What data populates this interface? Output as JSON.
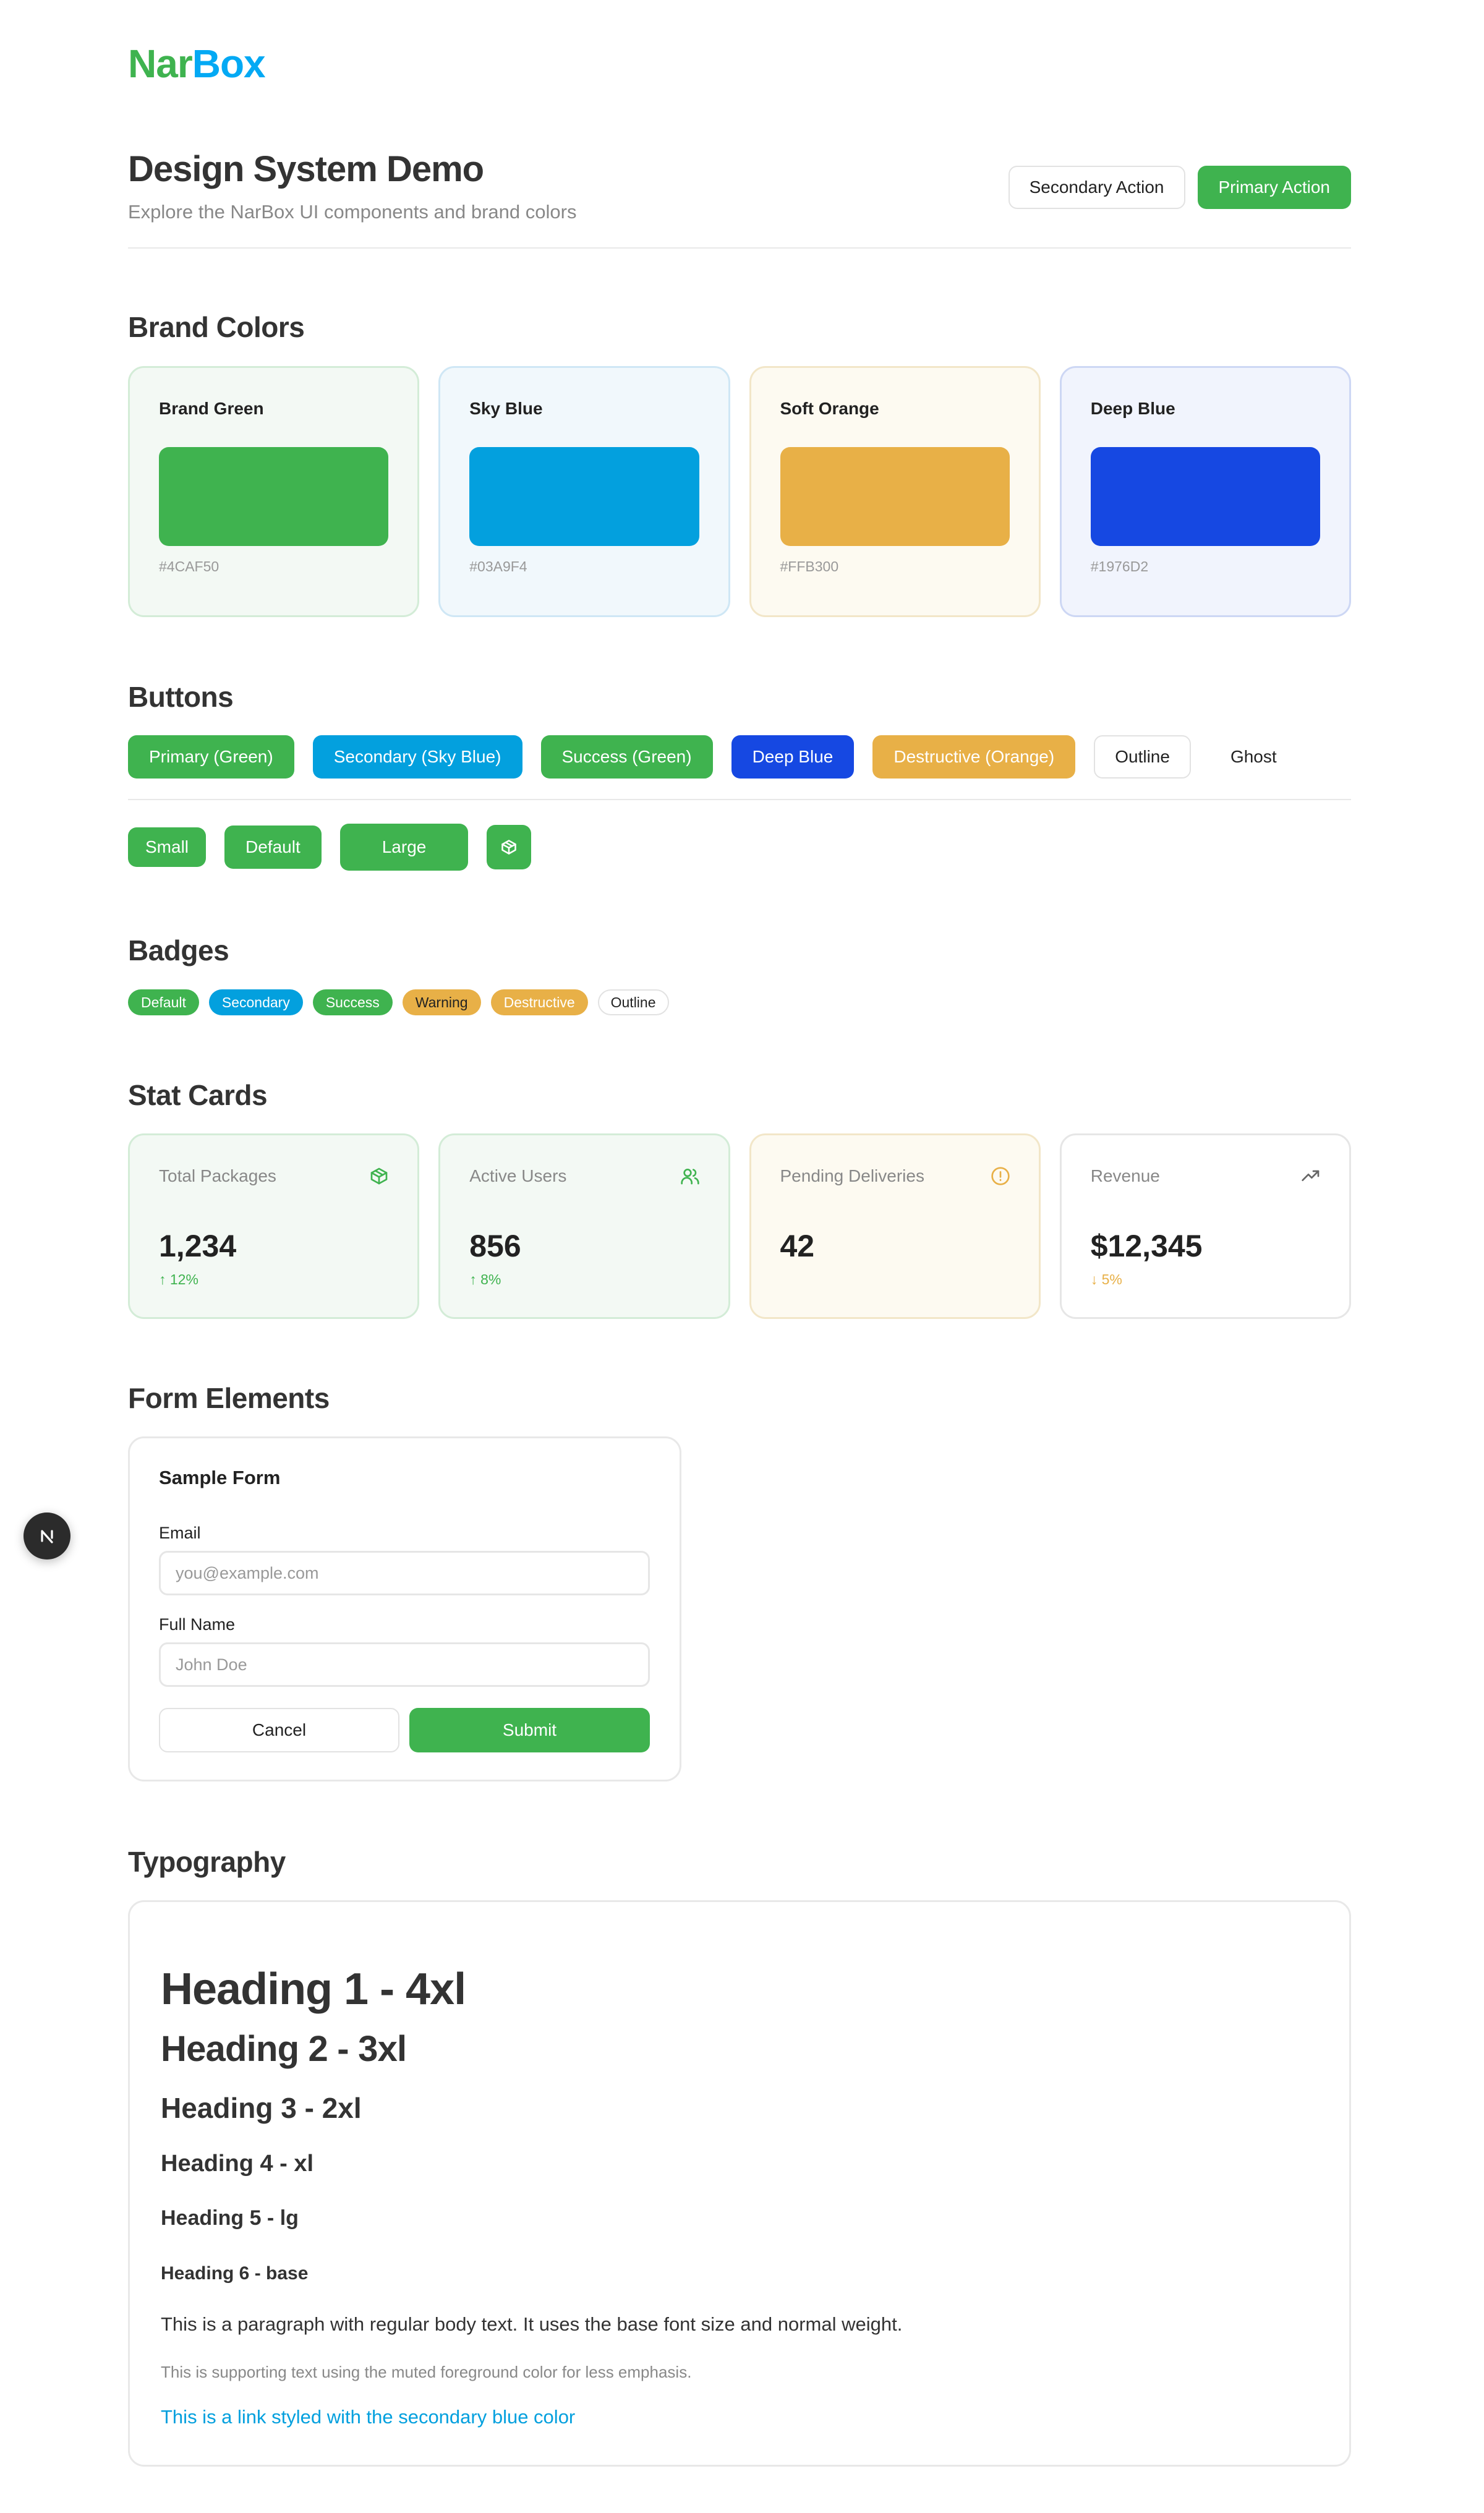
{
  "brand": {
    "name_part1": "Nar",
    "name_part2": "Box"
  },
  "header": {
    "title": "Design System Demo",
    "subtitle": "Explore the NarBox UI components and brand colors",
    "secondary_action": "Secondary Action",
    "primary_action": "Primary Action"
  },
  "sections": {
    "brand_colors": "Brand Colors",
    "buttons": "Buttons",
    "badges": "Badges",
    "stat_cards": "Stat Cards",
    "form_elements": "Form Elements",
    "typography": "Typography"
  },
  "colors": [
    {
      "name": "Brand Green",
      "hex": "#4CAF50",
      "swatch": "#3FB34F",
      "tint": "#F3F9F4",
      "border": "#D3ECD7"
    },
    {
      "name": "Sky Blue",
      "hex": "#03A9F4",
      "swatch": "#03A0DE",
      "tint": "#F1F8FC",
      "border": "#CFE7F5"
    },
    {
      "name": "Soft Orange",
      "hex": "#FFB300",
      "swatch": "#E8B047",
      "tint": "#FDFAF1",
      "border": "#F2E6C8"
    },
    {
      "name": "Deep Blue",
      "hex": "#1976D2",
      "swatch": "#1648E2",
      "tint": "#F1F4FD",
      "border": "#CDD7F4"
    }
  ],
  "buttons": {
    "variants": [
      "Primary (Green)",
      "Secondary (Sky Blue)",
      "Success (Green)",
      "Deep Blue",
      "Destructive (Orange)",
      "Outline",
      "Ghost"
    ],
    "sizes": [
      "Small",
      "Default",
      "Large"
    ],
    "icon_button": "package-icon"
  },
  "badges": [
    "Default",
    "Secondary",
    "Success",
    "Warning",
    "Destructive",
    "Outline"
  ],
  "stats": [
    {
      "label": "Total Packages",
      "value": "1,234",
      "change": "12%",
      "direction": "up",
      "icon": "package-icon",
      "accent": "#3FB34F",
      "tint": "#F3F9F4",
      "border": "#D3ECD7"
    },
    {
      "label": "Active Users",
      "value": "856",
      "change": "8%",
      "direction": "up",
      "icon": "users-icon",
      "accent": "#3FB34F",
      "tint": "#F3F9F4",
      "border": "#D3ECD7"
    },
    {
      "label": "Pending Deliveries",
      "value": "42",
      "change": "",
      "direction": "",
      "icon": "alert-circle-icon",
      "accent": "#E8B047",
      "tint": "#FDFAF1",
      "border": "#F2E6C8"
    },
    {
      "label": "Revenue",
      "value": "$12,345",
      "change": "5%",
      "direction": "down",
      "icon": "trending-up-icon",
      "accent": "#E8B047",
      "tint": "#FFFFFF",
      "border": "#E6E6E6"
    }
  ],
  "form": {
    "title": "Sample Form",
    "email_label": "Email",
    "email_placeholder": "you@example.com",
    "name_label": "Full Name",
    "name_placeholder": "John Doe",
    "cancel": "Cancel",
    "submit": "Submit"
  },
  "typography": {
    "h1": "Heading 1 - 4xl",
    "h2": "Heading 2 - 3xl",
    "h3": "Heading 3 - 2xl",
    "h4": "Heading 4 - xl",
    "h5": "Heading 5 - lg",
    "h6": "Heading 6 - base",
    "body": "This is a paragraph with regular body text. It uses the base font size and normal weight.",
    "muted": "This is supporting text using the muted foreground color for less emphasis.",
    "link": "This is a link styled with the secondary blue color"
  },
  "fab_letter": "N"
}
